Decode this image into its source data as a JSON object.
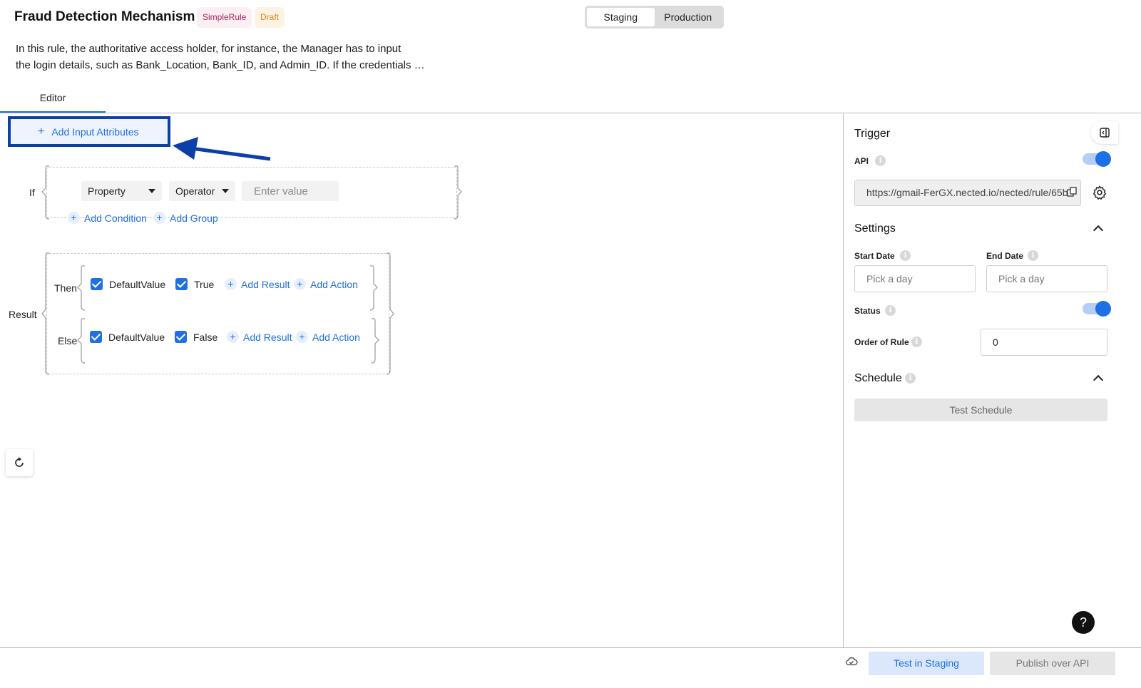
{
  "header": {
    "title": "Fraud Detection Mechanism",
    "badges": [
      "SimpleRule",
      "Draft"
    ],
    "env_options": [
      "Staging",
      "Production"
    ],
    "env_selected": "Staging",
    "description_line1": "In this rule, the authoritative access holder, for instance, the Manager has to input",
    "description_line2": "the login details, such as Bank_Location, Bank_ID, and Admin_ID. If the credentials …"
  },
  "tabs": [
    {
      "label": "Editor",
      "active": true
    }
  ],
  "editor": {
    "add_input_label": "Add Input Attributes",
    "condition": {
      "if_label": "If",
      "property": "Property",
      "operator": "Operator",
      "value_placeholder": "Enter value",
      "add_condition": "Add Condition",
      "add_group": "Add Group"
    },
    "result": {
      "result_label": "Result",
      "then": {
        "label": "Then",
        "items": [
          {
            "label": "DefaultValue",
            "checked": true
          },
          {
            "label": "True",
            "checked": true
          }
        ],
        "add_result": "Add Result",
        "add_action": "Add Action"
      },
      "else": {
        "label": "Else",
        "items": [
          {
            "label": "DefaultValue",
            "checked": true
          },
          {
            "label": "False",
            "checked": true
          }
        ],
        "add_result": "Add Result",
        "add_action": "Add Action"
      }
    }
  },
  "panel": {
    "trigger_title": "Trigger",
    "api_label": "API",
    "api_enabled": true,
    "api_url": "https://gmail-FerGX.nected.io/nected/rule/65b",
    "settings_title": "Settings",
    "start_date_label": "Start Date",
    "start_date_placeholder": "Pick a day",
    "end_date_label": "End Date",
    "end_date_placeholder": "Pick a day",
    "status_label": "Status",
    "status_enabled": true,
    "order_label": "Order of Rule",
    "order_value": "0",
    "schedule_title": "Schedule",
    "test_schedule": "Test Schedule"
  },
  "footer": {
    "test_staging": "Test in Staging",
    "publish": "Publish over API"
  },
  "help_label": "?",
  "colors": {
    "accent": "#1f6fe5",
    "highlight_border": "#0d3fa8"
  }
}
